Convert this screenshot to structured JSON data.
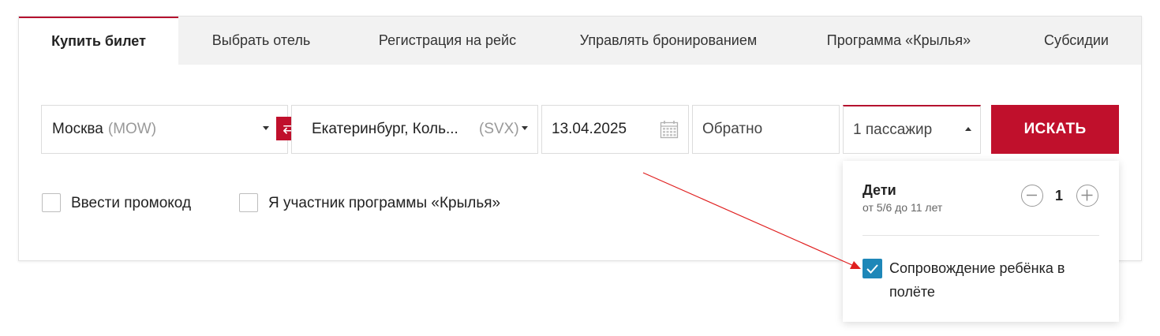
{
  "tabs": [
    {
      "label": "Купить билет",
      "active": true
    },
    {
      "label": "Выбрать отель",
      "active": false
    },
    {
      "label": "Регистрация на рейс",
      "active": false
    },
    {
      "label": "Управлять бронированием",
      "active": false
    },
    {
      "label": "Программа «Крылья»",
      "active": false
    },
    {
      "label": "Субсидии",
      "active": false
    }
  ],
  "form": {
    "origin_city": "Москва",
    "origin_code": "(MOW)",
    "destination_city": "Екатеринбург, Коль...",
    "destination_code": "(SVX)",
    "date_out": "13.04.2025",
    "date_return_placeholder": "Обратно",
    "passengers": "1 пассажир",
    "search_label": "ИСКАТЬ",
    "swap_icon": "⇄"
  },
  "options": {
    "promo_label": "Ввести промокод",
    "promo_checked": false,
    "wings_label": "Я участник программы «Крылья»",
    "wings_checked": false
  },
  "passenger_dropdown": {
    "category_title": "Дети",
    "category_subtitle": "от 5/6 до 11 лет",
    "count": "1",
    "escort_label_line1": "Сопровождение ребёнка в",
    "escort_label_line2": "полёте",
    "escort_checked": true
  },
  "colors": {
    "brand": "#c0102c",
    "checkbox_checked": "#1e87b8",
    "annotation_arrow": "#e02020"
  }
}
